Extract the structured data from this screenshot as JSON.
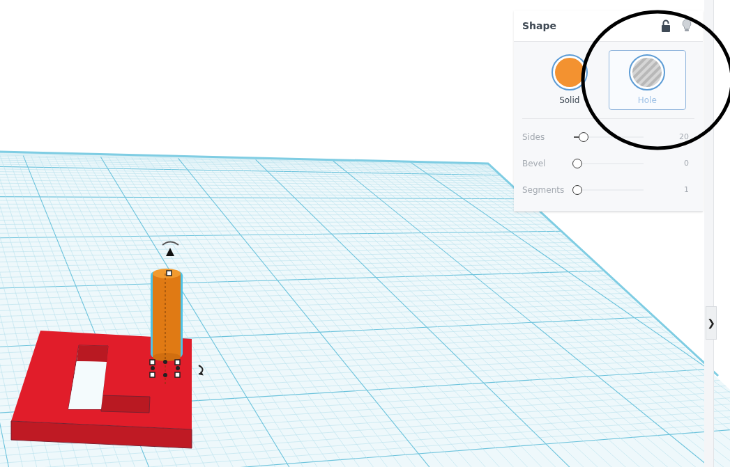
{
  "panel": {
    "title": "Shape",
    "locked": false,
    "shape_types": [
      {
        "label": "Solid",
        "kind": "solid",
        "selected": true,
        "hovered": false
      },
      {
        "label": "Hole",
        "kind": "hole",
        "selected": false,
        "hovered": true
      }
    ],
    "properties": [
      {
        "label": "Sides",
        "level": 0.1,
        "value": "20"
      },
      {
        "label": "Bevel",
        "level": 0,
        "value": "0"
      },
      {
        "label": "Segments",
        "level": 0,
        "value": "1"
      }
    ]
  },
  "side_tab": {
    "label": "❯"
  }
}
